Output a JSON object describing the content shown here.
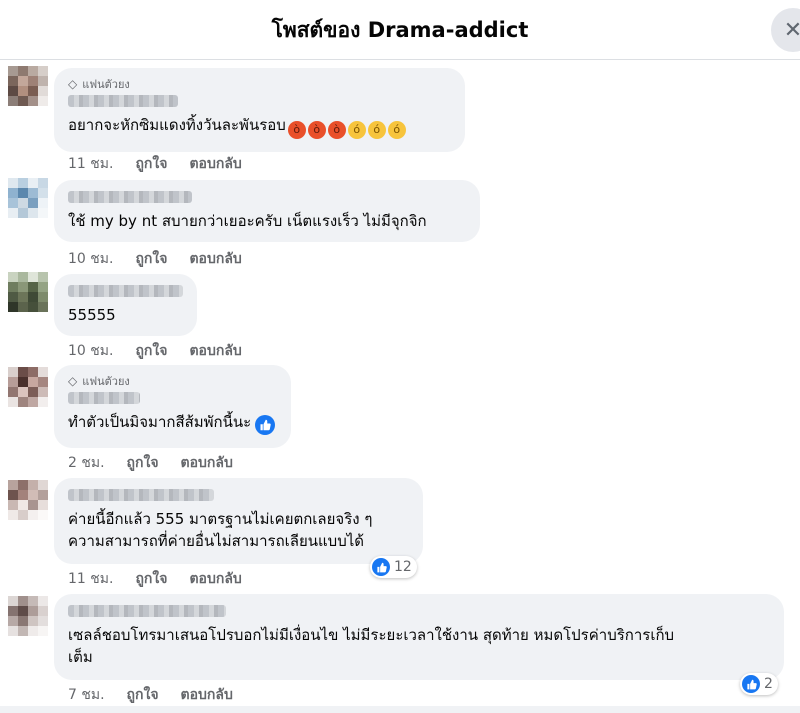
{
  "header": {
    "title": "โพสต์ของ Drama-addict",
    "close_symbol": "✕"
  },
  "badge_label": "แฟนตัวยง",
  "actions": {
    "like": "ถูกใจ",
    "reply": "ตอบกลับ"
  },
  "comments": [
    {
      "text": "อยากจะหักซิมแดงทิ้งวันละพันรอบ",
      "time": "11 ชม.",
      "emoji": [
        "angry",
        "angry",
        "angry",
        "steam",
        "steam",
        "steam"
      ]
    },
    {
      "text": "ใช้ my by nt สบายกว่าเยอะครับ เน็ตแรงเร็ว ไม่มีจุกจิก",
      "time": "10 ชม."
    },
    {
      "text": "55555",
      "time": "10 ชม."
    },
    {
      "text": "ทำตัวเป็นมิจมากสีส้มพักนี้นะ",
      "time": "2 ชม."
    },
    {
      "text_line1": "ค่ายนี้อีกแล้ว 555 มาตรฐานไม่เคยตกเลยจริง ๆ",
      "text_line2": "ความสามารถที่ค่ายอื่นไม่สามารถเลียนแบบได้",
      "time": "11 ชม.",
      "reactions": "12"
    },
    {
      "text_line1": "เซลล์ชอบโทรมาเสนอโปรบอกไม่มีเงื่อนไข ไม่มีระยะเวลาใช้งาน สุดท้าย หมดโปรค่าบริการเก็บ",
      "text_line2": "เต็ม",
      "time": "7 ชม.",
      "reactions": "2"
    }
  ],
  "colors": {
    "bubble": "#f0f2f5",
    "like_blue": "#1877f2",
    "meta_grey": "#65676b"
  }
}
